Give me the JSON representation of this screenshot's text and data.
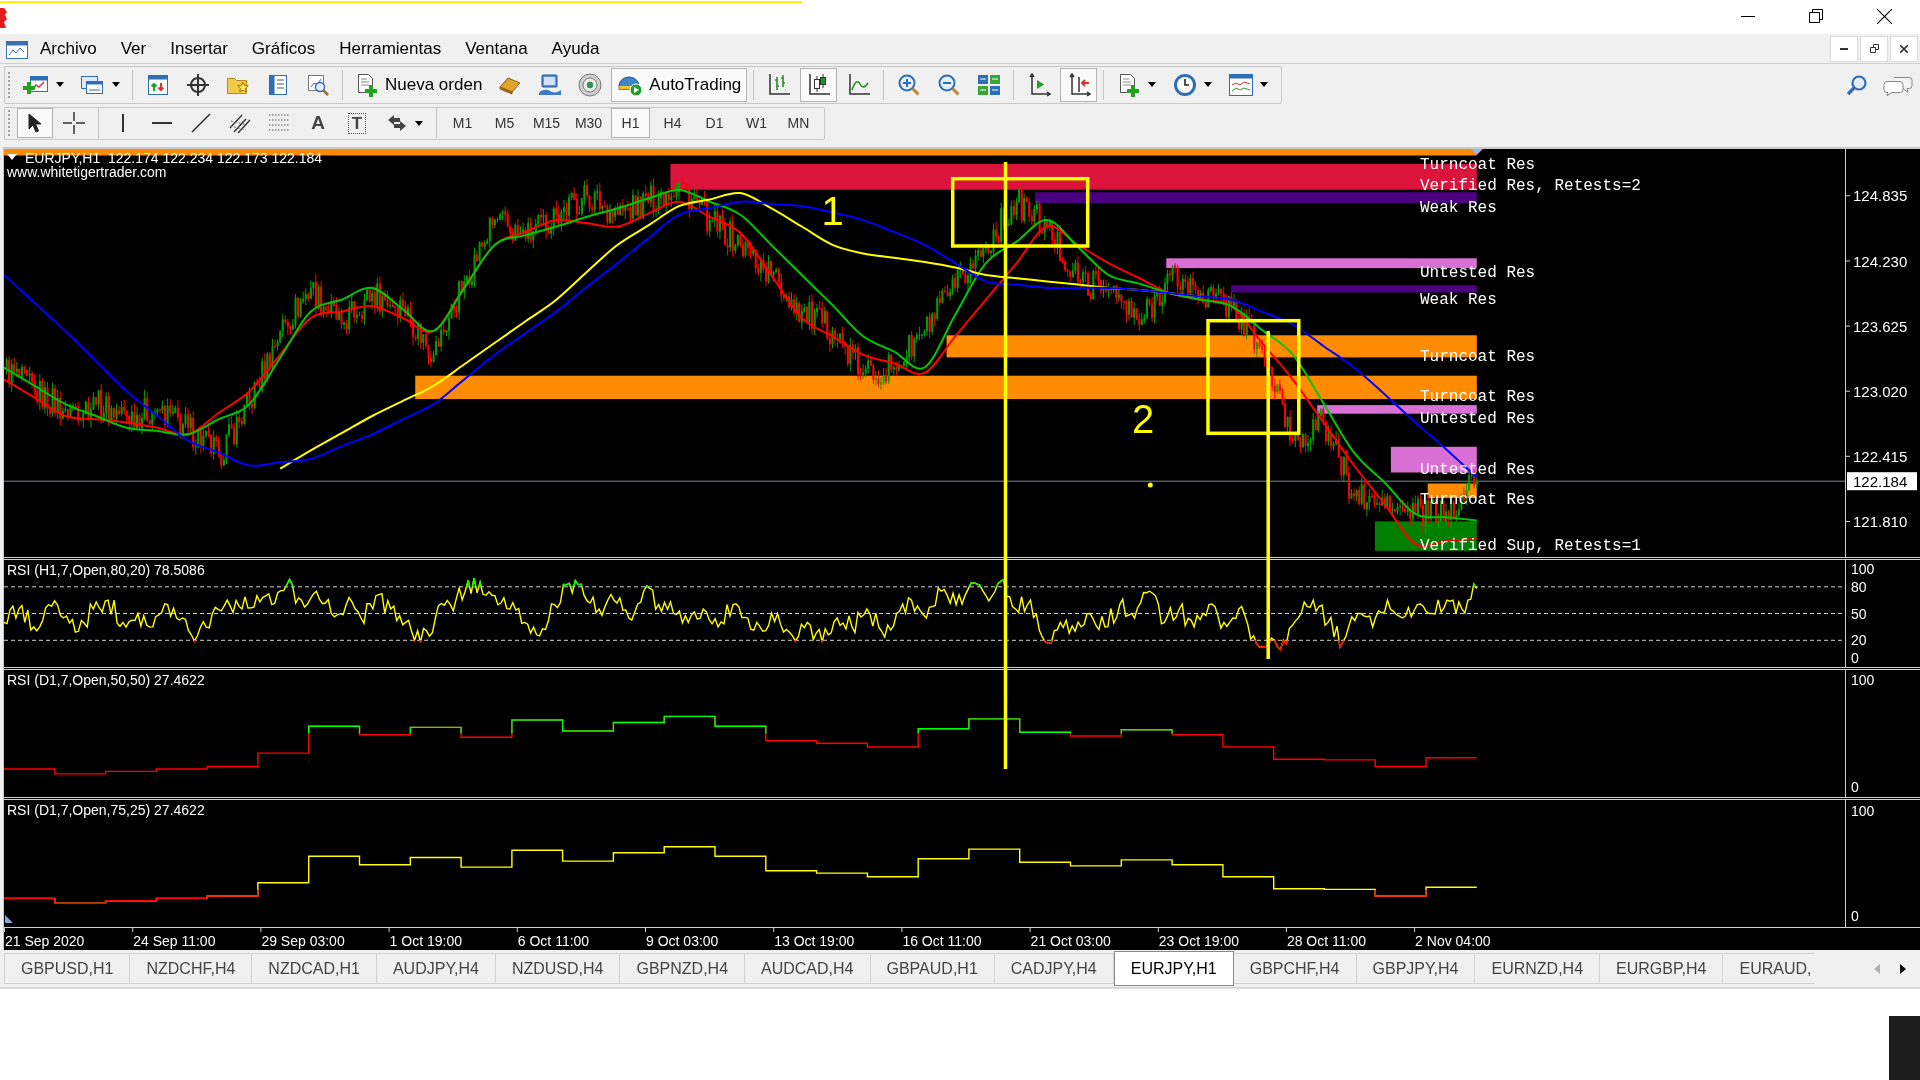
{
  "menu_bar": {
    "items": [
      "Archivo",
      "Ver",
      "Insertar",
      "Gráficos",
      "Herramientas",
      "Ventana",
      "Ayuda"
    ]
  },
  "standard_toolbar": {
    "new_order": {
      "label": "Nueva orden"
    },
    "autotrading": {
      "label": "AutoTrading",
      "on": true
    },
    "chart_types": [
      {
        "selected": false
      },
      {
        "selected": true
      },
      {
        "selected": false
      }
    ],
    "auto_scroll": {
      "on": false
    },
    "chart_shift": {
      "on": true
    }
  },
  "drawing_toolbar": {
    "modes": [
      {
        "selected": true
      },
      {
        "selected": false
      }
    ],
    "text_tool": "A",
    "label_tool": "T",
    "timeframes": [
      {
        "label": "M1",
        "selected": false
      },
      {
        "label": "M5",
        "selected": false
      },
      {
        "label": "M15",
        "selected": false
      },
      {
        "label": "M30",
        "selected": false
      },
      {
        "label": "H1",
        "selected": true
      },
      {
        "label": "H4",
        "selected": false
      },
      {
        "label": "D1",
        "selected": false
      },
      {
        "label": "W1",
        "selected": false
      },
      {
        "label": "MN",
        "selected": false
      }
    ]
  },
  "chart": {
    "main": {
      "title": "EURJPY,H1  122.174 122.234 122.173 122.184",
      "website": "www.whitetigertrader.com",
      "price_scale": [
        "124.835",
        "124.230",
        "123.625",
        "123.020",
        "122.415",
        "121.810"
      ],
      "current_price": "122.184",
      "zones": [
        {
          "label": "Turncoat Res",
          "color": "#ff8c00"
        },
        {
          "label": "Verified Res, Retests=2",
          "color": "#dc143c"
        },
        {
          "label": "Weak Res",
          "color": "#4b0082"
        },
        {
          "label": "Untested Res",
          "color": "#da70d6"
        },
        {
          "label": "Weak Res",
          "color": "#4b0082"
        },
        {
          "label": "Turncoat Res",
          "color": "#ff8c00"
        },
        {
          "label": "Turncoat Res",
          "color": "#ff8c00"
        },
        {
          "label": "Untested Res",
          "color": "#da70d6"
        },
        {
          "label": "Untested Res",
          "color": "#da70d6"
        },
        {
          "label": "Turncoat Res",
          "color": "#ff8c00"
        },
        {
          "label": "Verified Sup, Retests=1",
          "color": "#008000"
        }
      ],
      "markers": [
        {
          "label": "1"
        },
        {
          "label": "2"
        }
      ]
    },
    "indicators": [
      {
        "title": "RSI (H1,7,Open,80,20) 78.5086",
        "scale": [
          "100",
          "80",
          "50",
          "20",
          "0"
        ]
      },
      {
        "title": "RSI (D1,7,Open,50,50) 27.4622",
        "scale": [
          "100",
          "0"
        ]
      },
      {
        "title": "RSI (D1,7,Open,75,25) 27.4622",
        "scale": [
          "100",
          "0"
        ]
      }
    ],
    "time_scale": [
      "21 Sep 2020",
      "24 Sep 11:00",
      "29 Sep 03:00",
      "1 Oct 19:00",
      "6 Oct 11:00",
      "9 Oct 03:00",
      "13 Oct 19:00",
      "16 Oct 11:00",
      "21 Oct 03:00",
      "23 Oct 19:00",
      "28 Oct 11:00",
      "2 Nov 04:00"
    ]
  },
  "tabs": [
    {
      "label": "GBPUSD,H1",
      "selected": false
    },
    {
      "label": "NZDCHF,H4",
      "selected": false
    },
    {
      "label": "NZDCAD,H1",
      "selected": false
    },
    {
      "label": "AUDJPY,H4",
      "selected": false
    },
    {
      "label": "NZDUSD,H4",
      "selected": false
    },
    {
      "label": "GBPNZD,H4",
      "selected": false
    },
    {
      "label": "AUDCAD,H4",
      "selected": false
    },
    {
      "label": "GBPAUD,H1",
      "selected": false
    },
    {
      "label": "CADJPY,H4",
      "selected": false
    },
    {
      "label": "EURJPY,H1",
      "selected": true
    },
    {
      "label": "GBPCHF,H4",
      "selected": false
    },
    {
      "label": "GBPJPY,H4",
      "selected": false
    },
    {
      "label": "EURNZD,H4",
      "selected": false
    },
    {
      "label": "EURGBP,H4",
      "selected": false
    },
    {
      "label": "EURAUD,",
      "selected": false
    }
  ],
  "tab_scroll": {
    "left_disabled": true,
    "right_disabled": false
  }
}
